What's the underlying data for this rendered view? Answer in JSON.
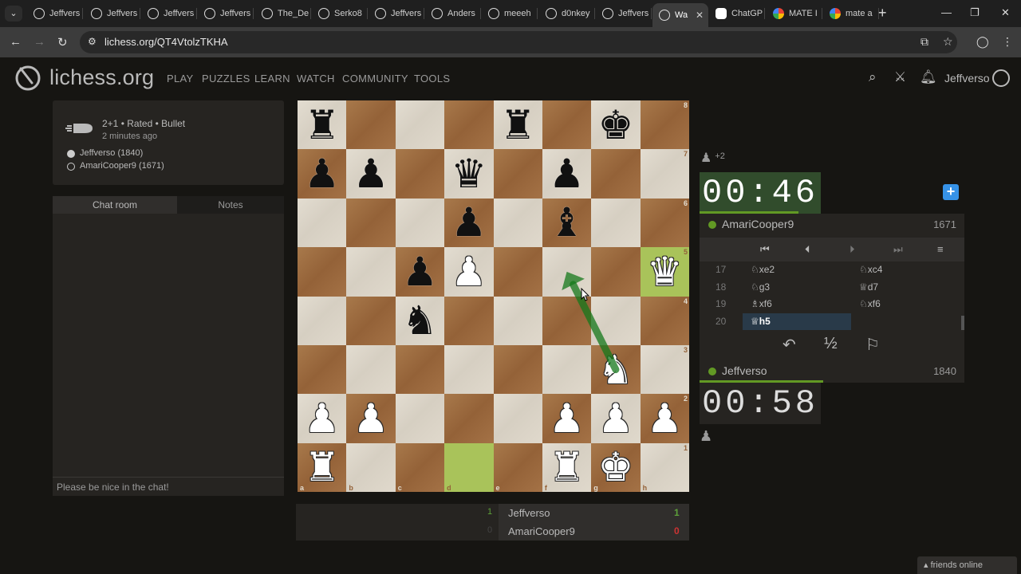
{
  "browser": {
    "tabs": [
      {
        "label": "Jeffvers",
        "icon": "lichess"
      },
      {
        "label": "Jeffvers",
        "icon": "lichess"
      },
      {
        "label": "Jeffvers",
        "icon": "lichess"
      },
      {
        "label": "Jeffvers",
        "icon": "lichess"
      },
      {
        "label": "The_De",
        "icon": "lichess"
      },
      {
        "label": "Serko8",
        "icon": "lichess"
      },
      {
        "label": "Jeffvers",
        "icon": "lichess"
      },
      {
        "label": "Anders",
        "icon": "lichess"
      },
      {
        "label": "meeeh",
        "icon": "lichess"
      },
      {
        "label": "d0nkey",
        "icon": "lichess"
      },
      {
        "label": "Jeffvers",
        "icon": "lichess"
      },
      {
        "label": "Wa",
        "icon": "lichess",
        "active": true
      },
      {
        "label": "ChatGP",
        "icon": "chatgpt"
      },
      {
        "label": "MATE I",
        "icon": "google"
      },
      {
        "label": "mate a",
        "icon": "google"
      }
    ],
    "url": "lichess.org/QT4VtolzTKHA"
  },
  "header": {
    "logo": "lichess",
    "logo_suffix": ".org",
    "nav": [
      "PLAY",
      "PUZZLES",
      "LEARN",
      "WATCH",
      "COMMUNITY",
      "TOOLS"
    ],
    "username": "Jeffverso"
  },
  "game": {
    "setup": "2+1 • Rated • Bullet",
    "time_ago": "2 minutes ago",
    "white_player": "Jeffverso (1840)",
    "black_player": "AmariCooper9 (1671)"
  },
  "chat": {
    "tab_chat": "Chat room",
    "tab_notes": "Notes",
    "placeholder": "Please be nice in the chat!"
  },
  "board": {
    "ranks": [
      "8",
      "7",
      "6",
      "5",
      "4",
      "3",
      "2",
      "1"
    ],
    "files": [
      "a",
      "b",
      "c",
      "d",
      "e",
      "f",
      "g",
      "h"
    ],
    "position": [
      [
        "bR",
        "",
        "",
        "",
        "bR",
        "",
        "bK",
        ""
      ],
      [
        "bP",
        "bP",
        "",
        "bQ",
        "",
        "bP",
        "",
        ""
      ],
      [
        "",
        "",
        "",
        "bP",
        "",
        "bB",
        "",
        ""
      ],
      [
        "",
        "",
        "bP",
        "wP",
        "",
        "",
        "",
        "wQ"
      ],
      [
        "",
        "",
        "bN",
        "",
        "",
        "",
        "",
        ""
      ],
      [
        "",
        "",
        "",
        "",
        "",
        "",
        "wN",
        ""
      ],
      [
        "wP",
        "wP",
        "",
        "",
        "",
        "wP",
        "wP",
        "wP"
      ],
      [
        "wR",
        "",
        "",
        "",
        "",
        "wR",
        "wK",
        ""
      ]
    ],
    "last_move_from": "d1",
    "last_move_to": "h5",
    "arrow_from": "g3",
    "arrow_to": "f5",
    "arrow_color": "#15781b"
  },
  "top_player": {
    "name": "AmariCooper9",
    "rating": "1671",
    "clock": "00:46",
    "material": "+2"
  },
  "bottom_player": {
    "name": "Jeffverso",
    "rating": "1840",
    "clock": "00:58"
  },
  "moves": [
    {
      "num": "17",
      "white": "♘xe2",
      "black": "♘xc4"
    },
    {
      "num": "18",
      "white": "♘g3",
      "black": "♕d7"
    },
    {
      "num": "19",
      "white": "♗xf6",
      "black": "♘xf6"
    },
    {
      "num": "20",
      "white": "♕h5",
      "black": ""
    }
  ],
  "actions": {
    "draw": "½"
  },
  "score": {
    "white_name": "Jeffverso",
    "black_name": "AmariCooper9",
    "white_left": "1",
    "black_left": "0",
    "white_right": "1",
    "black_right": "0"
  },
  "footer": {
    "friends": "friends online"
  },
  "colors": {
    "accent_green": "#629924",
    "highlight": "#cdd26a",
    "background": "#161512"
  }
}
